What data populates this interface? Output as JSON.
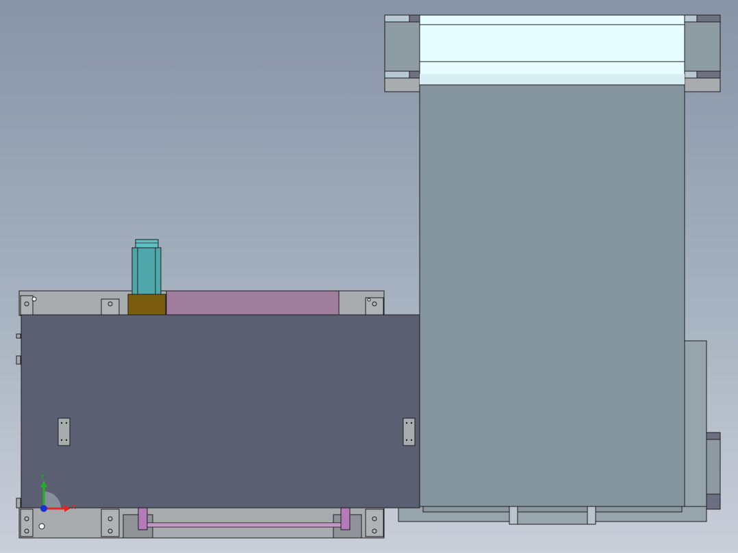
{
  "viewport": {
    "name": "cad-graphics-area",
    "view": "front"
  },
  "triad": {
    "x_label": "X",
    "y_label": "Y",
    "x_color": "#e0281e",
    "y_color": "#22b022",
    "z_color": "#1c2fd0"
  },
  "colors": {
    "background_top": "#8794a6",
    "background_bottom": "#c9cfd9",
    "front_panel": "#5a6072",
    "tall_housing": "#85959d",
    "bracket_gray": "#a8acaf",
    "glass": "#e8fdff",
    "motor_teal": "#4fa7ab",
    "motor_base": "#7a5d0f",
    "pink_plate": "#9e7e9c",
    "rod_purple": "#b57ab8"
  }
}
